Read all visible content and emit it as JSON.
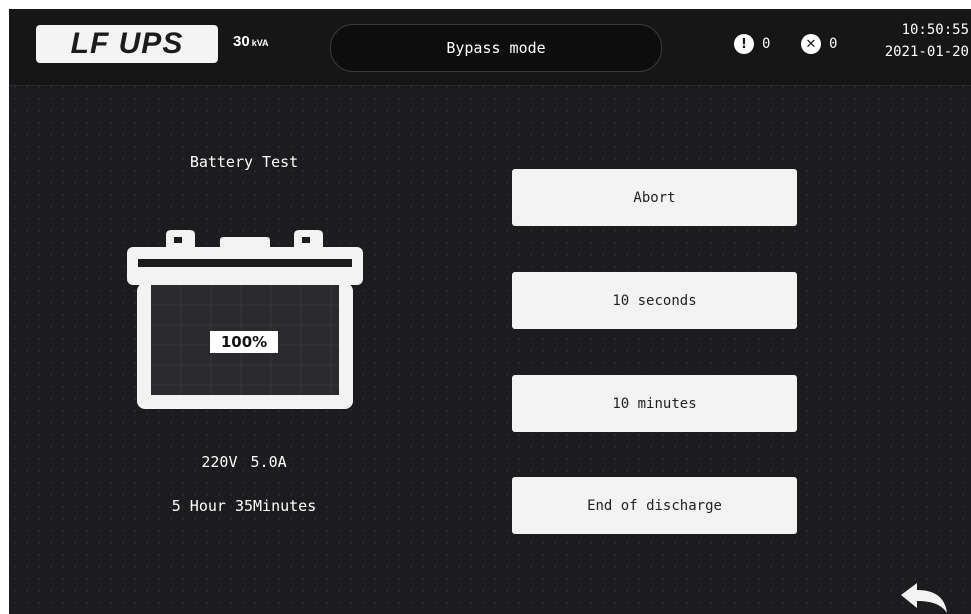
{
  "header": {
    "logo": "LF UPS",
    "capacity_value": "30",
    "capacity_unit": "kVA",
    "mode": "Bypass mode",
    "warning_count": "0",
    "fault_count": "0",
    "time": "10:50:55",
    "date": "2021-01-20"
  },
  "battery_test": {
    "title": "Battery Test",
    "charge_percent": "100%",
    "voltage": "220V",
    "current": "5.0A",
    "remaining_time": "5 Hour 35Minutes"
  },
  "actions": {
    "abort_label": "Abort",
    "ten_seconds_label": "10 seconds",
    "ten_minutes_label": "10 minutes",
    "end_discharge_label": "End of discharge"
  },
  "icons": {
    "warning": "exclamation-circle-icon",
    "fault": "x-circle-icon",
    "back": "back-arrow-icon"
  },
  "colors": {
    "background": "#1c1c1e",
    "button": "#f3f3f3",
    "text": "#ffffff"
  }
}
